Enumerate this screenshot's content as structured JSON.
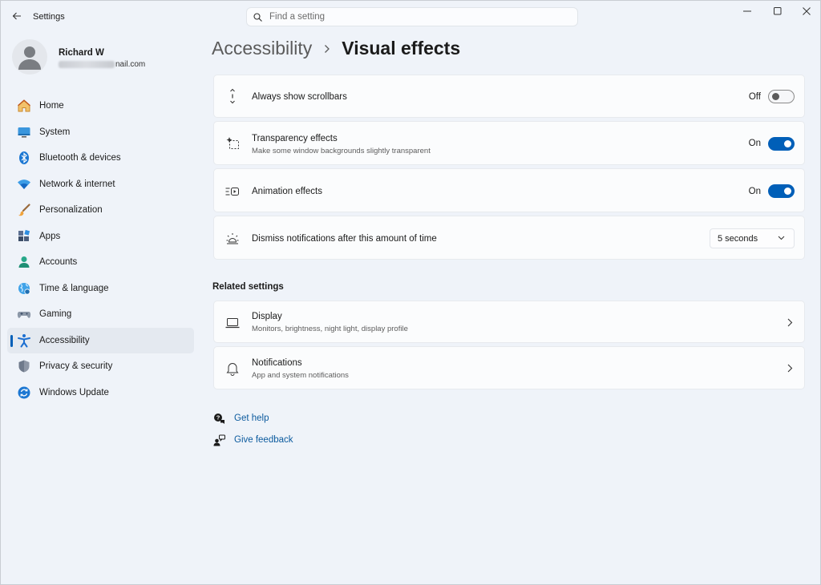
{
  "window": {
    "app_title": "Settings"
  },
  "search": {
    "placeholder": "Find a setting",
    "value": ""
  },
  "profile": {
    "name": "Richard W",
    "email_visible_suffix": "nail.com"
  },
  "sidebar": {
    "items": [
      {
        "label": "Home",
        "icon": "home-icon"
      },
      {
        "label": "System",
        "icon": "system-icon"
      },
      {
        "label": "Bluetooth & devices",
        "icon": "bluetooth-icon"
      },
      {
        "label": "Network & internet",
        "icon": "wifi-icon"
      },
      {
        "label": "Personalization",
        "icon": "brush-icon"
      },
      {
        "label": "Apps",
        "icon": "apps-icon"
      },
      {
        "label": "Accounts",
        "icon": "accounts-icon"
      },
      {
        "label": "Time & language",
        "icon": "globe-icon"
      },
      {
        "label": "Gaming",
        "icon": "gamepad-icon"
      },
      {
        "label": "Accessibility",
        "icon": "accessibility-icon",
        "active": true
      },
      {
        "label": "Privacy & security",
        "icon": "shield-icon"
      },
      {
        "label": "Windows Update",
        "icon": "update-icon"
      }
    ]
  },
  "breadcrumb": {
    "parent": "Accessibility",
    "current": "Visual effects"
  },
  "settings": {
    "scrollbars": {
      "title": "Always show scrollbars",
      "state": "Off",
      "enabled": false
    },
    "transparency": {
      "title": "Transparency effects",
      "subtitle": "Make some window backgrounds slightly transparent",
      "state": "On",
      "enabled": true
    },
    "animation": {
      "title": "Animation effects",
      "state": "On",
      "enabled": true
    },
    "notifications_timeout": {
      "title": "Dismiss notifications after this amount of time",
      "selected": "5 seconds"
    }
  },
  "related": {
    "heading": "Related settings",
    "items": [
      {
        "title": "Display",
        "subtitle": "Monitors, brightness, night light, display profile"
      },
      {
        "title": "Notifications",
        "subtitle": "App and system notifications"
      }
    ]
  },
  "links": {
    "get_help": "Get help",
    "give_feedback": "Give feedback"
  },
  "colors": {
    "accent": "#005fb8",
    "background": "#eff3f9",
    "card": "#fbfcfd",
    "link": "#0b5a9e"
  }
}
